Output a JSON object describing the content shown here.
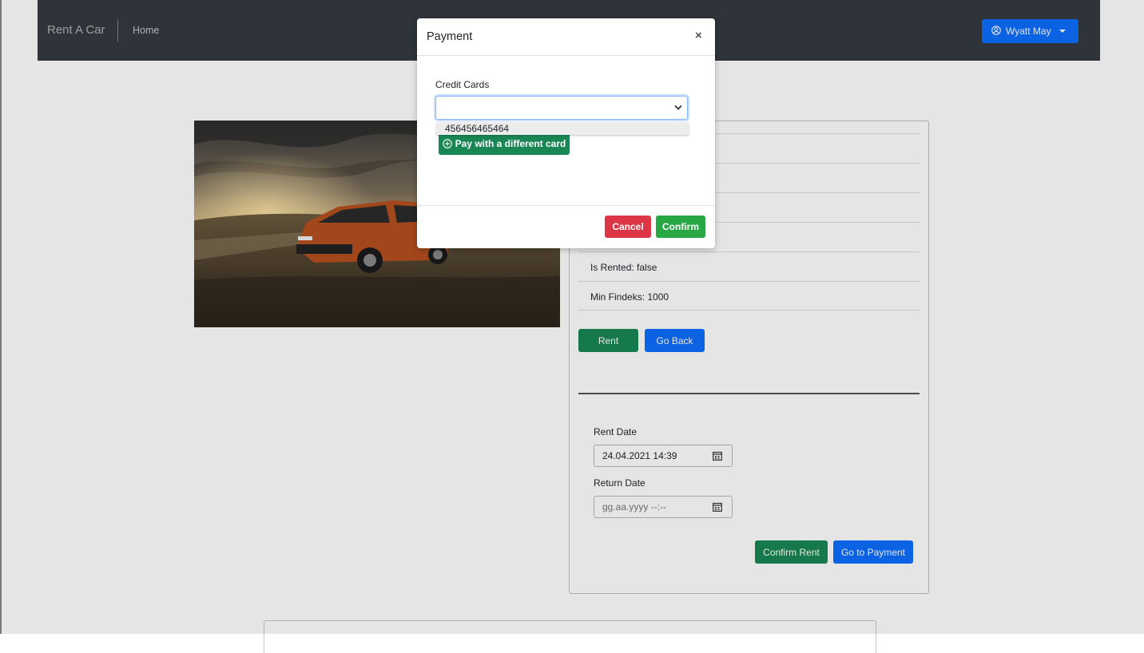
{
  "navbar": {
    "brand": "Rent A Car",
    "home_link": "Home",
    "user_name": "Wyatt May"
  },
  "car_image": {
    "alt": "orange crossover car on gravel road at sunset"
  },
  "car_details": {
    "rows": [
      {
        "label": "Is Rented: false"
      },
      {
        "label": "Min Findeks: 1000"
      }
    ]
  },
  "actions": {
    "rent_label": "Rent",
    "go_back_label": "Go Back"
  },
  "rent_form": {
    "rent_date_label": "Rent Date",
    "rent_date_value": "24.04.2021 14:39",
    "return_date_label": "Return Date",
    "return_date_placeholder": "gg.aa.yyyy --:--",
    "confirm_rent_label": "Confirm Rent",
    "go_to_payment_label": "Go to Payment"
  },
  "modal": {
    "title": "Payment",
    "close_symbol": "×",
    "credit_cards_label": "Credit Cards",
    "selected_card": "",
    "dropdown_options": [
      "456456465464"
    ],
    "pay_different_label": "Pay with a different card",
    "cancel_label": "Cancel",
    "confirm_label": "Confirm"
  },
  "colors": {
    "navbar": "#343a40",
    "primary": "#0d6efd",
    "success": "#198754",
    "danger": "#dc3545"
  }
}
